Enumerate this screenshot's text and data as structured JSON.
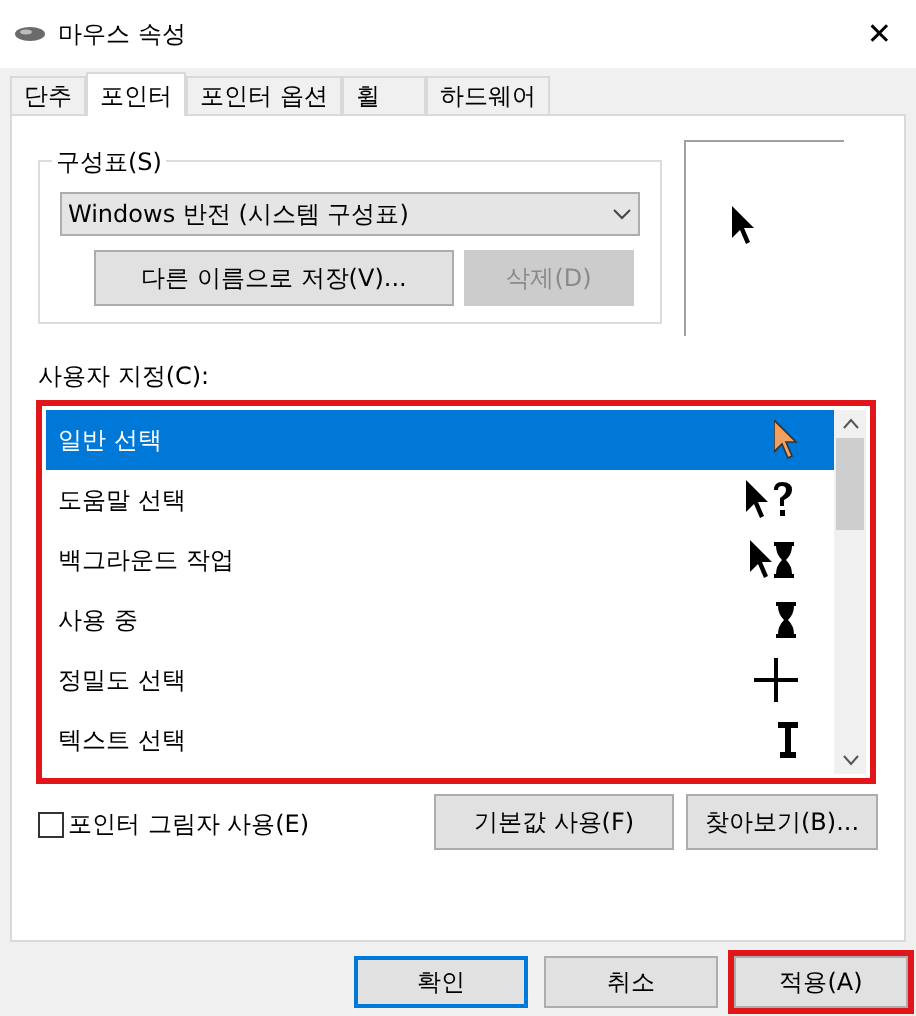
{
  "window": {
    "title": "마우스 속성",
    "close": "✕"
  },
  "tabs": [
    {
      "label": "단추",
      "selected": false
    },
    {
      "label": "포인터",
      "selected": true
    },
    {
      "label": "포인터 옵션",
      "selected": false
    },
    {
      "label": "휠",
      "selected": false
    },
    {
      "label": "하드웨어",
      "selected": false
    }
  ],
  "scheme": {
    "label": "구성표(S)",
    "value": "Windows 반전 (시스템 구성표)",
    "buttons": [
      {
        "label": "다른 이름으로 저장(V)...",
        "disabled": false
      },
      {
        "label": "삭제(D)",
        "disabled": true
      }
    ]
  },
  "customize": {
    "label": "사용자 지정(C):",
    "highlighted": true,
    "items": [
      {
        "label": "일반 선택",
        "kind": "arrow",
        "selected": true
      },
      {
        "label": "도움말 선택",
        "kind": "help",
        "selected": false
      },
      {
        "label": "백그라운드 작업",
        "kind": "working",
        "selected": false
      },
      {
        "label": "사용 중",
        "kind": "busy",
        "selected": false
      },
      {
        "label": "정밀도 선택",
        "kind": "precision",
        "selected": false
      },
      {
        "label": "텍스트 선택",
        "kind": "text",
        "selected": false
      }
    ]
  },
  "shadow": {
    "label": "포인터 그림자 사용(E)",
    "checked": false
  },
  "panel_buttons": [
    "기본값 사용(F)",
    "찾아보기(B)..."
  ],
  "buttons": [
    {
      "label": "확인",
      "default": true,
      "highlighted": false
    },
    {
      "label": "취소",
      "default": false,
      "highlighted": false
    },
    {
      "label": "적용(A)",
      "default": false,
      "highlighted": true
    }
  ]
}
